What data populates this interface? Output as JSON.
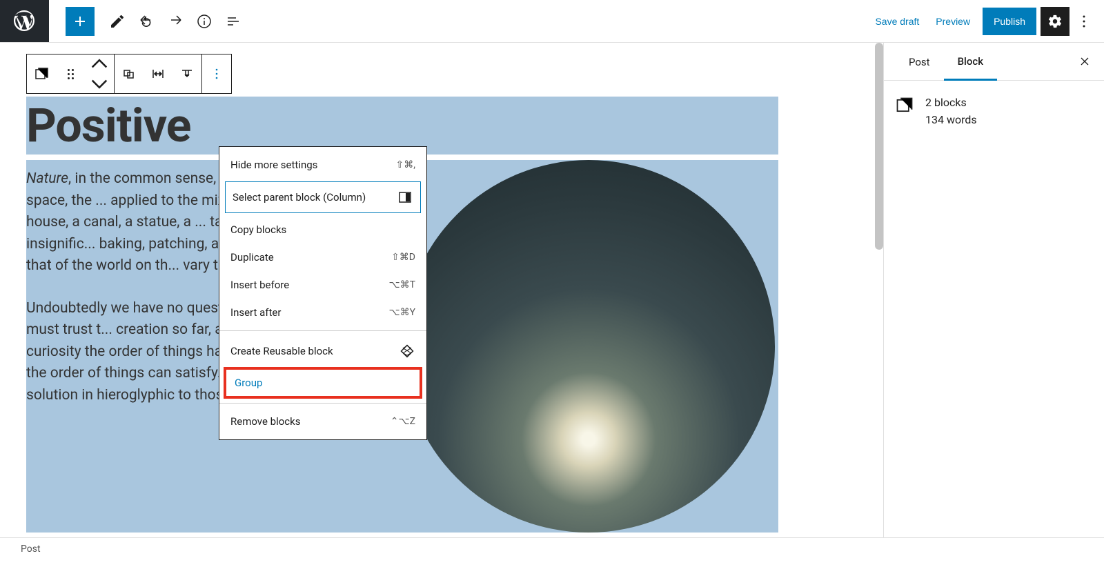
{
  "toolbar": {
    "save_draft": "Save draft",
    "preview": "Preview",
    "publish": "Publish"
  },
  "content": {
    "heading": "Positive",
    "para1_italic": "Nature",
    "para1_rest": ", in the common sense, ... unchanged by man; space, the ... applied to the mixture of his wi... in a house, a canal, a statue, a ... taken together are so insignific... baking, patching, and washing,... grand as that of the world on th... vary the result.",
    "para2": "Undoubtedly we have no quest... unanswerable. We must trust t... creation so far, as to believe that whatever curiosity the order of things has awakened in our minds, the order of things can satisfy. Every man's condition is a solution in hieroglyphic to those inquiries he would put."
  },
  "dropdown": {
    "hide_settings": "Hide more settings",
    "hide_settings_key": "⇧⌘,",
    "select_parent": "Select parent block (Column)",
    "copy": "Copy blocks",
    "duplicate": "Duplicate",
    "duplicate_key": "⇧⌘D",
    "insert_before": "Insert before",
    "insert_before_key": "⌥⌘T",
    "insert_after": "Insert after",
    "insert_after_key": "⌥⌘Y",
    "reusable": "Create Reusable block",
    "group": "Group",
    "remove": "Remove blocks",
    "remove_key": "⌃⌥Z"
  },
  "sidebar": {
    "tab_post": "Post",
    "tab_block": "Block",
    "blocks_count": "2 blocks",
    "words_count": "134 words"
  },
  "bottom": {
    "breadcrumb": "Post"
  }
}
